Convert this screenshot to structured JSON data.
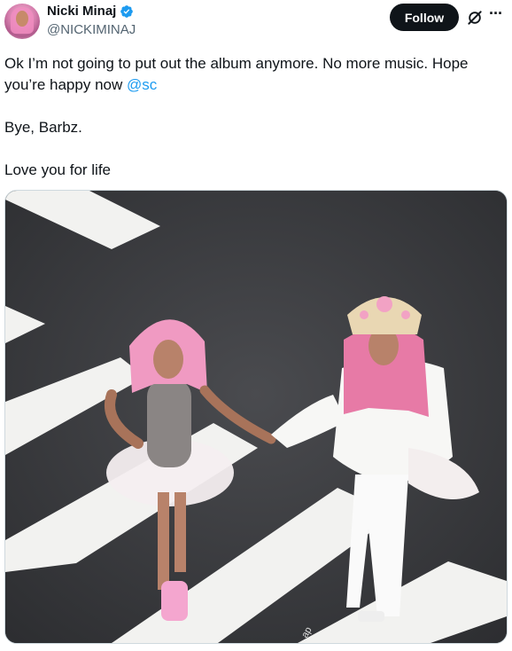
{
  "author": {
    "name": "Nicki Minaj",
    "handle": "@NICKIMINAJ",
    "verified": true
  },
  "actions": {
    "follow_label": "Follow"
  },
  "tweet": {
    "line1": "Ok I’m not going to put out the album anymore. No more music. Hope",
    "line2_text": "you’re happy now ",
    "line2_mention": "@sc",
    "line3": "Bye, Barbz.",
    "line4": "Love you for life"
  },
  "media": {
    "watermark": "ap"
  },
  "colors": {
    "mention": "#1d9bf0",
    "verified_badge": "#1d9bf0",
    "follow_button_bg": "#0f1419",
    "secondary_text": "#536471"
  },
  "icons": [
    "verified-badge-icon",
    "grok-icon",
    "more-options-icon"
  ]
}
